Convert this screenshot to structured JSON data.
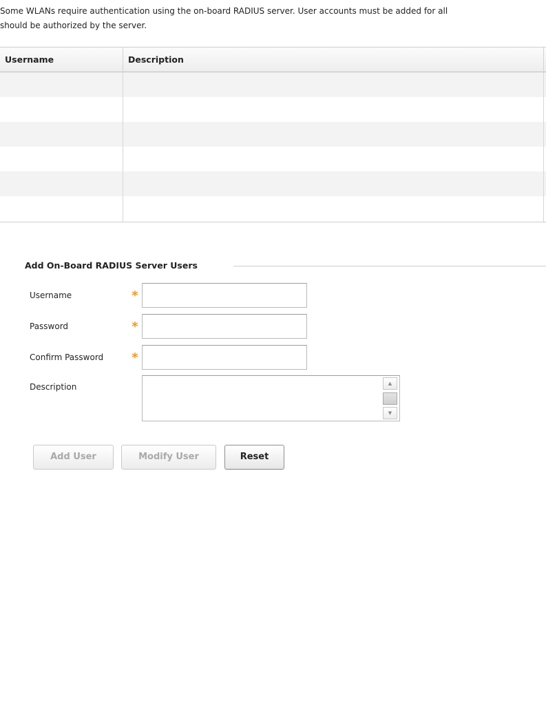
{
  "intro": {
    "line1": "Some WLANs require authentication using the on-board RADIUS server.  User accounts must be added for all",
    "line2": "should be authorized by the server."
  },
  "users_table": {
    "columns": [
      "Username",
      "Description"
    ],
    "rows": [
      {
        "username": "",
        "description": ""
      },
      {
        "username": "",
        "description": ""
      },
      {
        "username": "",
        "description": ""
      },
      {
        "username": "",
        "description": ""
      },
      {
        "username": "",
        "description": ""
      },
      {
        "username": "",
        "description": ""
      }
    ]
  },
  "add_user_form": {
    "legend": "Add On-Board RADIUS Server Users",
    "fields": {
      "username": {
        "label": "Username",
        "value": "",
        "required": true
      },
      "password": {
        "label": "Password",
        "value": "",
        "required": true
      },
      "confirm_password": {
        "label": "Confirm Password",
        "value": "",
        "required": true
      },
      "description": {
        "label": "Description",
        "value": "",
        "required": false
      }
    },
    "required_marker": "*",
    "buttons": {
      "add": {
        "label": "Add User",
        "enabled": false
      },
      "modify": {
        "label": "Modify User",
        "enabled": false
      },
      "reset": {
        "label": "Reset",
        "enabled": true
      }
    }
  },
  "colors": {
    "required_star": "#f7941d",
    "row_alt": "#f3f3f3",
    "border": "#cfcfcf"
  }
}
